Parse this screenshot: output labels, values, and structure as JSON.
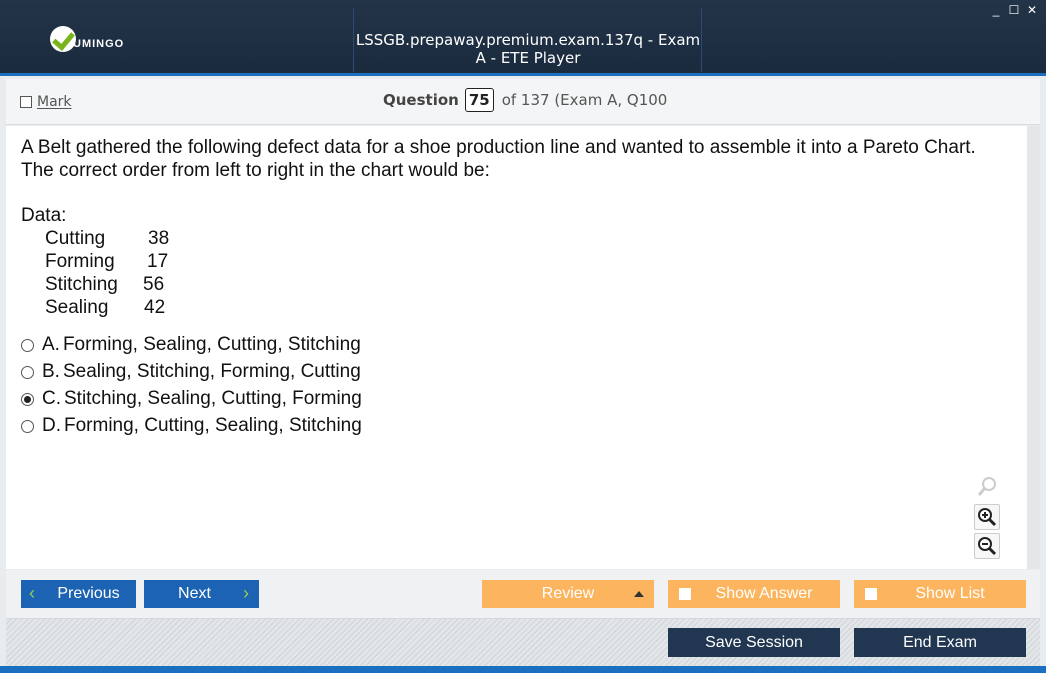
{
  "window": {
    "brand": "UMINGO",
    "title": "LSSGB.prepaway.premium.exam.137q - Exam A - ETE Player",
    "controls": {
      "minimize": "_",
      "maximize": "☐",
      "close": "✕"
    }
  },
  "question_bar": {
    "mark_label": "Mark",
    "question_label": "Question",
    "question_number": "75",
    "of_text": "of 137 (Exam A, Q100"
  },
  "question": {
    "stem": "A Belt gathered the following defect data for a shoe production line and wanted to assemble it into a Pareto Chart. The correct order from left to right in the chart would be:",
    "data_label": "Data:",
    "data_rows": [
      {
        "name": "Cutting",
        "value": "38"
      },
      {
        "name": "Forming",
        "value": "17"
      },
      {
        "name": "Stitching",
        "value": "56"
      },
      {
        "name": "Sealing",
        "value": "42"
      }
    ],
    "options": [
      {
        "letter": "A.",
        "text": "Forming, Sealing, Cutting, Stitching",
        "selected": false
      },
      {
        "letter": "B.",
        "text": "Sealing, Stitching, Forming, Cutting",
        "selected": false
      },
      {
        "letter": "C.",
        "text": "Stitching, Sealing, Cutting, Forming",
        "selected": true
      },
      {
        "letter": "D.",
        "text": "Forming, Cutting, Sealing, Stitching",
        "selected": false
      }
    ]
  },
  "zoom": {
    "icons": [
      "search-icon",
      "zoom-in-icon",
      "zoom-out-icon"
    ]
  },
  "nav": {
    "previous": "Previous",
    "next": "Next",
    "review": "Review",
    "show_answer": "Show Answer",
    "show_list": "Show List",
    "save_session": "Save Session",
    "end_exam": "End Exam"
  },
  "colors": {
    "titlebar": "#1b2b3e",
    "accent_blue": "#1c64b3",
    "orange": "#fcb55e",
    "dark_button": "#213650",
    "logo_green": "#7ab41c"
  }
}
